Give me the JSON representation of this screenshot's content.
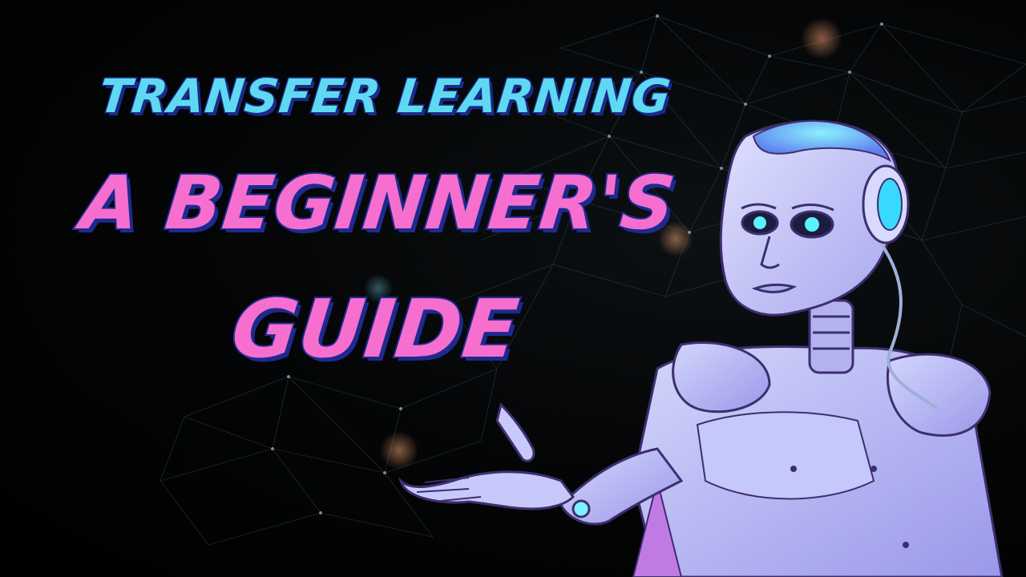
{
  "title": {
    "line1": "TRANSFER LEARNING",
    "line2": "A BEGINNER'S",
    "line3": "GUIDE"
  },
  "illustration": {
    "subject": "robot-icon",
    "background": "neural-network-mesh"
  },
  "colors": {
    "background": "#000000",
    "line1_fill": "#5fd9f2",
    "line23_fill": "#f66fcf",
    "text_outline": "#1e2a8f",
    "robot_body": "#b9bdf5",
    "robot_shadow": "#7d78d8",
    "robot_glow": "#39d9ff",
    "robot_pink": "#c37ae6"
  }
}
